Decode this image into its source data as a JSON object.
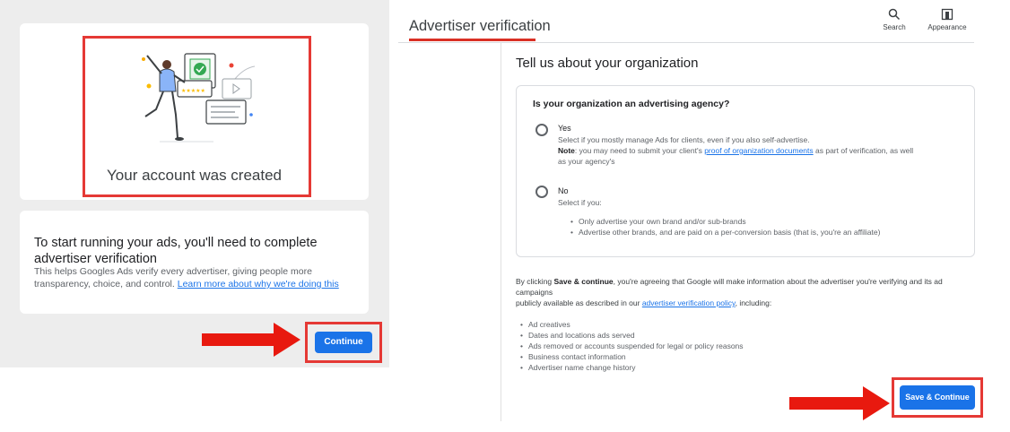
{
  "left": {
    "created_text": "Your account was created",
    "start_title": "To start running your ads, you'll need to complete advertiser verification",
    "start_body": "This helps Googles Ads verify every advertiser, giving people more transparency, choice, and control.",
    "learn_link": "Learn more about why we're doing this",
    "continue_label": "Continue"
  },
  "header": {
    "title": "Advertiser verification",
    "search_label": "Search",
    "appearance_label": "Appearance"
  },
  "form": {
    "heading": "Tell us about your organization",
    "question": "Is your organization an advertising agency?",
    "yes": {
      "label": "Yes",
      "desc": "Select if you mostly manage Ads for clients, even if you also self-advertise.",
      "note_bold": "Note",
      "note_pre": ": you may need to submit your client's ",
      "note_link": "proof of organization documents",
      "note_post": " as part of verification, as well",
      "note_tail": "as your agency's"
    },
    "no": {
      "label": "No",
      "desc": "Select if you:",
      "bullets": [
        "Only advertise your own brand and/or sub-brands",
        "Advertise other brands, and are paid on a per-conversion basis (that is, you're an affiliate)"
      ]
    }
  },
  "consent": {
    "pre": "By clicking ",
    "bold": "Save & continue",
    "post": ", you're agreeing that Google will make information about the advertiser you're verifying and its ad",
    "line2": "campaigns",
    "line3_pre": "publicly available as described in our ",
    "policy_link": "advertiser verification policy",
    "line3_post": ", including:",
    "items": [
      "Ad creatives",
      "Dates and locations ads served",
      "Ads removed or accounts suspended for legal or policy reasons",
      "Business contact information",
      "Advertiser name change history"
    ],
    "save_label": "Save & Continue"
  },
  "colors": {
    "accent": "#1a73e8",
    "highlight": "#e53935",
    "arrow": "#e8190f"
  }
}
